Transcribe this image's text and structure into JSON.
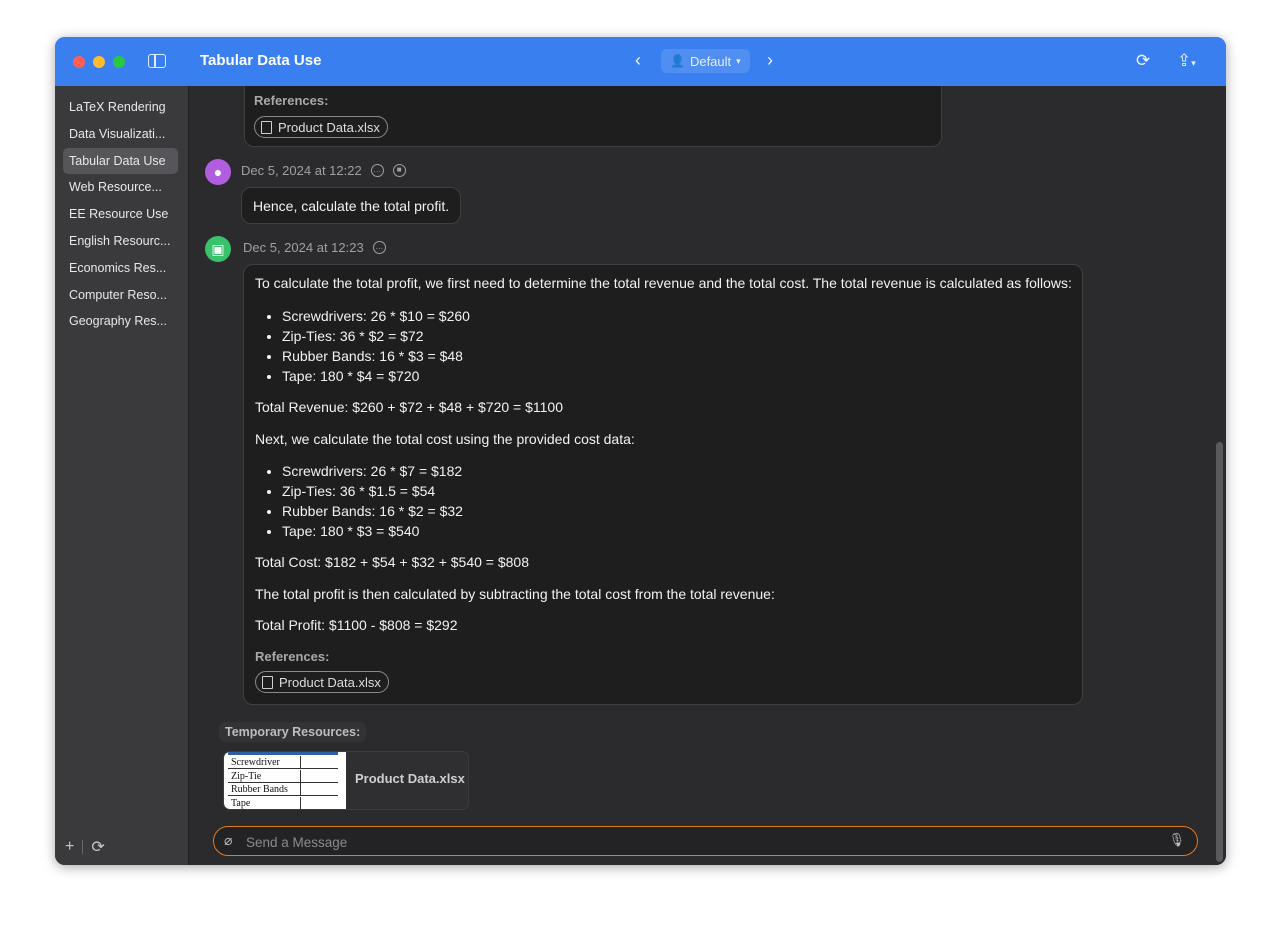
{
  "window": {
    "title": "Tabular Data Use"
  },
  "toolbar": {
    "profile": "Default"
  },
  "sidebar": {
    "items": [
      {
        "label": "LaTeX Rendering",
        "active": false
      },
      {
        "label": "Data Visualizati...",
        "active": false
      },
      {
        "label": "Tabular Data Use",
        "active": true
      },
      {
        "label": "Web Resource...",
        "active": false
      },
      {
        "label": "EE Resource Use",
        "active": false
      },
      {
        "label": "English Resourc...",
        "active": false
      },
      {
        "label": "Economics Res...",
        "active": false
      },
      {
        "label": "Computer Reso...",
        "active": false
      },
      {
        "label": "Geography Res...",
        "active": false
      }
    ],
    "footer": {
      "add": "+",
      "sync": "⟳"
    }
  },
  "chat": {
    "prev": {
      "references_label": "References:",
      "reference": "Product Data.xlsx"
    },
    "user_msg": {
      "timestamp": "Dec 5, 2024 at 12:22",
      "text": "Hence, calculate the total profit."
    },
    "bot_msg": {
      "timestamp": "Dec 5, 2024 at 12:23",
      "intro": "To calculate the total profit, we first need to determine the total revenue and the total cost. The total revenue is calculated as follows:",
      "revenue_items": [
        "Screwdrivers: 26 * $10 = $260",
        "Zip-Ties: 36 * $2 = $72",
        "Rubber Bands: 16 * $3 = $48",
        "Tape: 180 * $4 = $720"
      ],
      "total_revenue": "Total Revenue: $260 + $72 + $48 + $720 = $1100",
      "cost_intro": "Next, we calculate the total cost using the provided cost data:",
      "cost_items": [
        "Screwdrivers: 26 * $7 = $182",
        "Zip-Ties: 36 * $1.5 = $54",
        "Rubber Bands: 16 * $2 = $32",
        "Tape: 180 * $3 = $540"
      ],
      "total_cost": "Total Cost: $182 + $54 + $32 + $540 = $808",
      "profit_intro": "The total profit is then calculated by subtracting the total cost from the total revenue:",
      "total_profit": "Total Profit: $1100 - $808 = $292",
      "references_label": "References:",
      "reference": "Product Data.xlsx"
    }
  },
  "temp_resources": {
    "label": "Temporary Resources:",
    "file_name": "Product Data.xlsx",
    "thumb_rows": [
      "Screwdriver",
      "Zip-Tie",
      "Rubber Bands",
      "Tape"
    ]
  },
  "composer": {
    "placeholder": "Send a Message"
  },
  "colors": {
    "titlebar": "#3a7ff0",
    "input_border": "#e07a21",
    "user_avatar": "#b15de0",
    "bot_avatar": "#3ac26a"
  }
}
